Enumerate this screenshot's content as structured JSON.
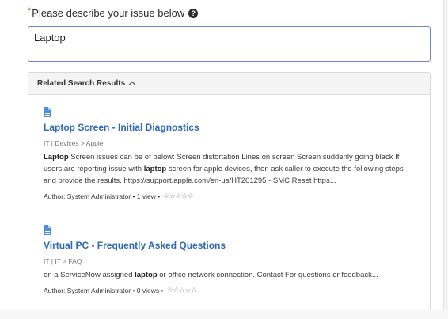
{
  "form": {
    "required_mark": "*",
    "question_label": "Please describe your issue below",
    "help_icon_glyph": "?",
    "issue_value": "Laptop"
  },
  "related": {
    "header": "Related Search Results",
    "results": [
      {
        "icon": "document-icon",
        "title": "Laptop Screen - Initial Diagnostics",
        "path": "IT | Devices > Apple",
        "snippet_parts": [
          {
            "text": "Laptop",
            "bold": true
          },
          {
            "text": " Screen issues can be of below: Screen distortation Lines on screen Screen suddenly going black If users are reporting issue with ",
            "bold": false
          },
          {
            "text": "laptop",
            "bold": true
          },
          {
            "text": " screen for apple devices, then ask caller to execute the following steps and provide the results. https://support.apple.com/en-us/HT201295 - SMC Reset https...",
            "bold": false
          }
        ],
        "author": "Author: System Administrator",
        "views": "1 view",
        "stars": "☆☆☆☆☆"
      },
      {
        "icon": "document-icon",
        "title": "Virtual PC - Frequently Asked Questions",
        "path": "IT | IT > FAQ",
        "snippet_parts": [
          {
            "text": "on a ServiceNow assigned ",
            "bold": false
          },
          {
            "text": "laptop",
            "bold": true
          },
          {
            "text": " or office network connection.    Contact For questions or feedback...",
            "bold": false
          }
        ],
        "author": "Author: System Administrator",
        "views": "0 views",
        "stars": "☆☆☆☆☆"
      }
    ]
  },
  "colors": {
    "link": "#2e6ab5",
    "input_border": "#6f86c9",
    "doc_icon": "#4a90d9"
  }
}
